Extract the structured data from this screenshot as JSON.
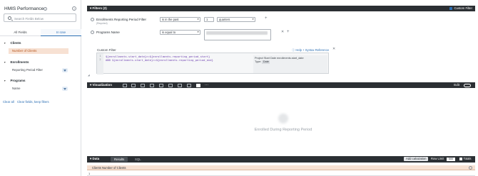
{
  "left_panel": {
    "title": "HMIS Performance",
    "search_placeholder": "Search Fields Below",
    "tabs": [
      "All Fields",
      "In Use"
    ],
    "groups": [
      {
        "name": "Clients",
        "fields": [
          "Number of Clients"
        ]
      },
      {
        "name": "Enrollments",
        "fields": [
          "Reporting Period Filter"
        ]
      },
      {
        "name": "Programs",
        "fields": [
          "Name"
        ]
      }
    ],
    "clear_all": "Clear all",
    "clear_keep": "Clear fields, keep filters"
  },
  "filters": {
    "header": "Filters (2)",
    "custom_filter_toggle": "Custom Filter",
    "rows": [
      {
        "label": "Enrollments Reporting Period Filter",
        "sublabel": "(Required)",
        "operator": "is in the past",
        "number": "1",
        "unit": "quarters"
      },
      {
        "label": "Programs Name",
        "operator": "is equal to"
      }
    ],
    "custom_filter": {
      "label": "Custom Filter",
      "help_link": "Help + Syntax Reference",
      "line_numbers": [
        "1",
        "2"
      ],
      "code": [
        "${enrollments.start_date}>=${enrollments.reporting_period_start}",
        "AND ${enrollments.start_date}<=${enrollments.reporting_period_end}"
      ],
      "hint": {
        "title": "Project Start Date enrollments.start_date",
        "type_label": "Type:",
        "type_value": "Date"
      }
    }
  },
  "visualization": {
    "header": "Visualization",
    "edit_label": "Edit",
    "empty_label": "Enrolled During Reporting Period"
  },
  "data": {
    "header": "Data",
    "tabs": [
      "Results",
      "SQL"
    ],
    "add_calculation": "Add calculation",
    "row_limit_label": "Row Limit",
    "row_limit_value": "500",
    "totals_label": "Totals",
    "column": "Clients Number of Clients",
    "row_number": "1"
  }
}
